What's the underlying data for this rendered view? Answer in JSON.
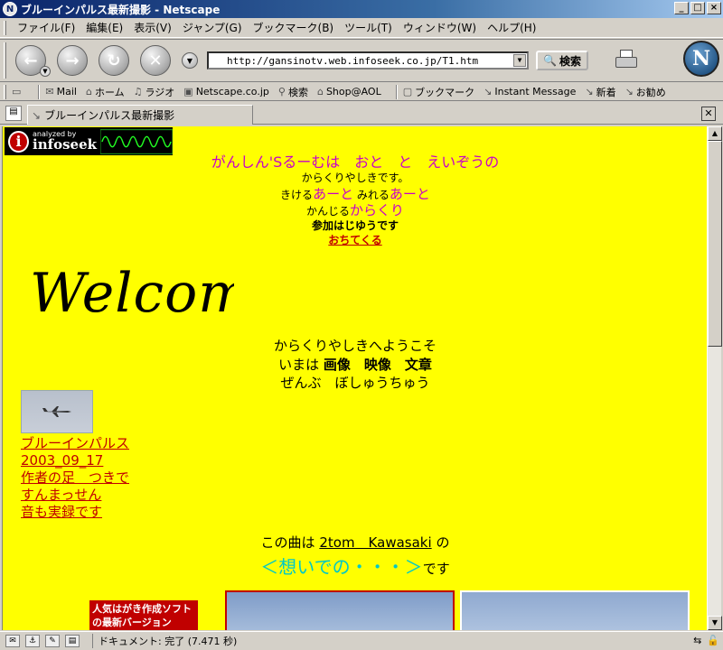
{
  "window": {
    "title": "ブルーインパルス最新撮影 - Netscape",
    "buttons": [
      "_",
      "□",
      "×"
    ]
  },
  "menu": [
    "ファイル(F)",
    "編集(E)",
    "表示(V)",
    "ジャンプ(G)",
    "ブックマーク(B)",
    "ツール(T)",
    "ウィンドウ(W)",
    "ヘルプ(H)"
  ],
  "nav": {
    "url": "http://gansinotv.web.infoseek.co.jp/T1.htm",
    "search_label": "検索"
  },
  "personal_toolbar": [
    "Mail",
    "ホーム",
    "ラジオ",
    "Netscape.co.jp",
    "検索",
    "Shop@AOL",
    "ブックマーク",
    "Instant Message",
    "新着",
    "お勧め"
  ],
  "tab": {
    "label": "ブルーインパルス最新撮影"
  },
  "page": {
    "infoseek_small": "analyzed by",
    "infoseek_big": "infoseek",
    "header": "がんしん'Sるーむは　おと　と　えいぞうの",
    "line2": "からくりやしきです。",
    "line3_a": "きける",
    "line3_b": "あーと",
    "line3_c": "みれる",
    "line3_d": "あーと",
    "line4_a": "かんじる",
    "line4_b": "からくり",
    "line5": "参加はじゆうです",
    "line6": "おちてくる",
    "welcome": "Welcome",
    "jp1": "からくりやしきへようこそ",
    "jp2_a": "いまは",
    "jp2_b": "画像　映像　文章",
    "jp3": "ぜんぶ　ぼしゅうちゅう",
    "links": [
      "ブルーインパルス",
      "2003_09_17",
      "作者の足　つきで",
      "すんまっせん",
      "音も実録です"
    ],
    "song_a": "この曲は",
    "song_link": "2tom　Kawasaki",
    "song_b": "の",
    "song2_a": "＜想いでの・・・＞",
    "song2_b": "です",
    "ad_line1": "人気はがき作成ソフト",
    "ad_line2": "の最新バージョン"
  },
  "status": {
    "text": "ドキュメント: 完了 (7.471 秒)"
  },
  "colors": {
    "page_bg": "#ffff00",
    "magenta": "#c800c8",
    "link_red": "#c00000",
    "cyan": "#00c8c8"
  }
}
